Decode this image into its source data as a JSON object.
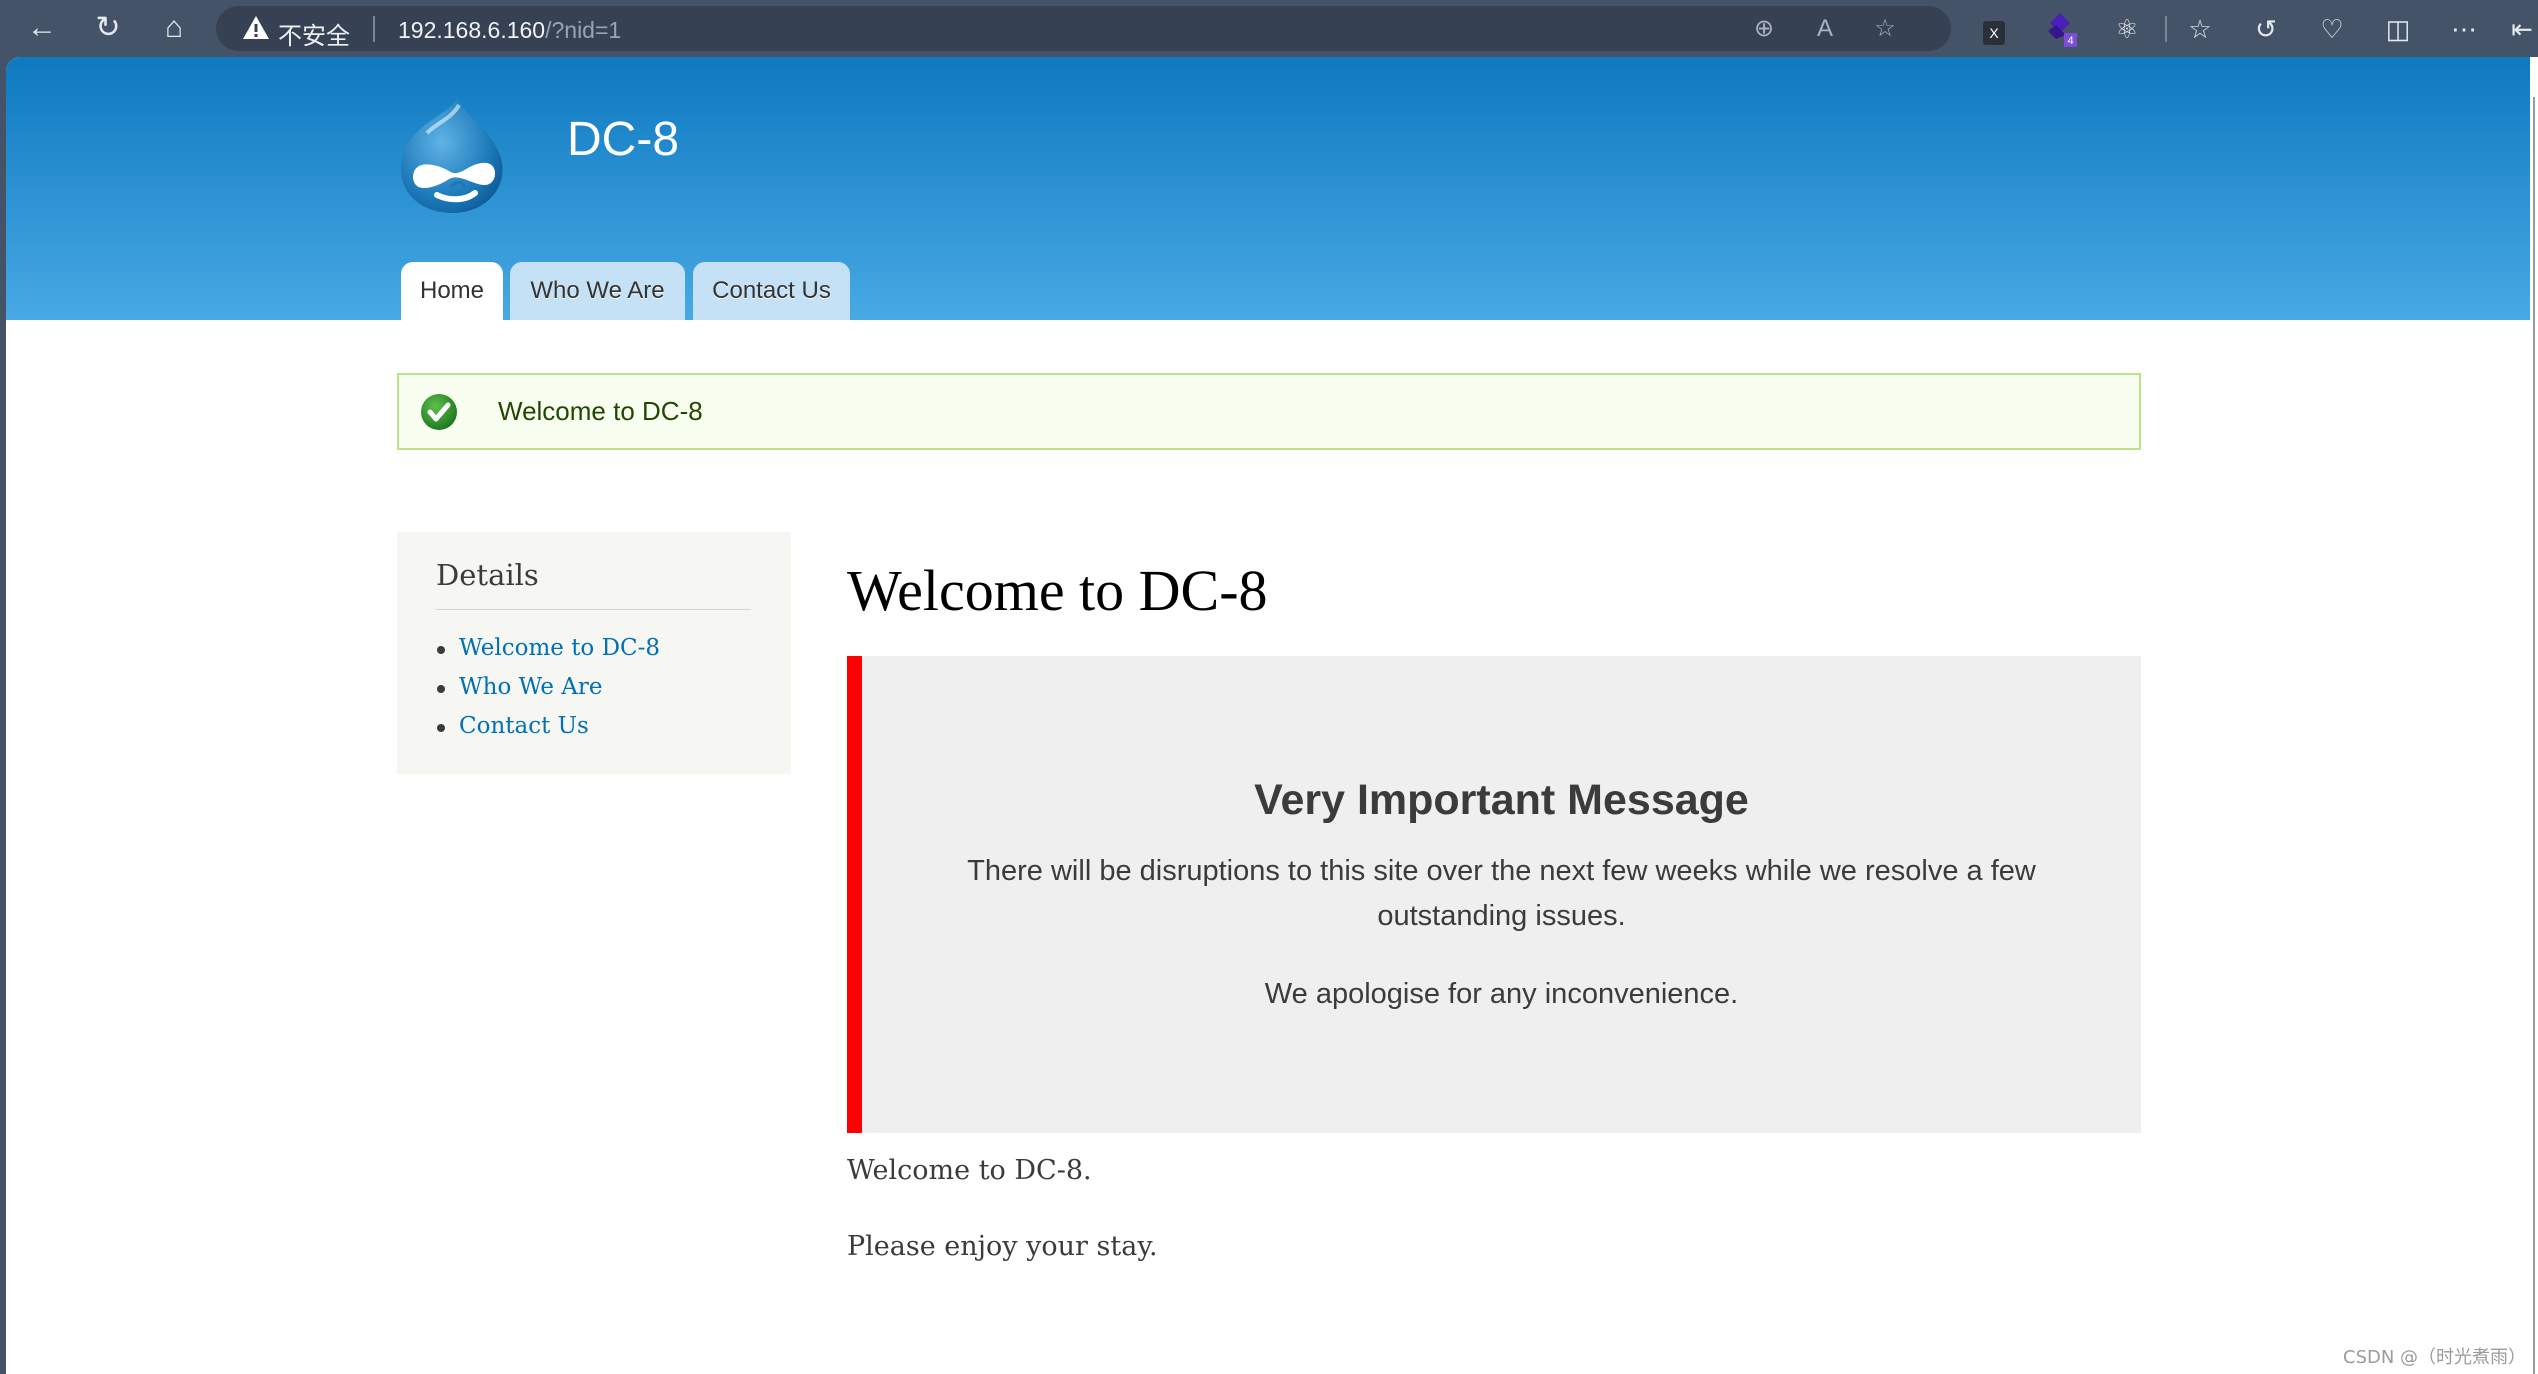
{
  "browser": {
    "security_label": "不安全",
    "url_host": "192.168.6.160",
    "url_path": "/?nid=1",
    "extension_badge_count": "4",
    "nav_icons": [
      "back-icon",
      "refresh-icon",
      "home-icon"
    ],
    "address_icons": [
      "zoom-icon",
      "read-aloud-icon",
      "favorite-star-icon"
    ],
    "toolbar_icons": [
      "x-extension-icon",
      "extension-badge-icon",
      "extensions-puzzle-icon",
      "favorites-icon",
      "history-icon",
      "browser-essentials-icon",
      "collections-icon",
      "more-icon"
    ]
  },
  "site": {
    "name": "DC-8",
    "tabs": [
      {
        "label": "Home",
        "active": true
      },
      {
        "label": "Who We Are",
        "active": false
      },
      {
        "label": "Contact Us",
        "active": false
      }
    ]
  },
  "status_message": "Welcome to DC-8",
  "sidebar": {
    "title": "Details",
    "links": [
      "Welcome to DC-8",
      "Who We Are",
      "Contact Us"
    ]
  },
  "main": {
    "title": "Welcome to DC-8",
    "notice": {
      "heading": "Very Important Message",
      "paragraph1": "There will be disruptions to this site over the next few weeks while we resolve a few outstanding issues.",
      "paragraph2": "We apologise for any inconvenience.",
      "accent_color": "#ff0000"
    },
    "body": [
      "Welcome to DC-8.",
      "Please enjoy your stay."
    ]
  },
  "watermark": "CSDN @（时光煮雨）"
}
